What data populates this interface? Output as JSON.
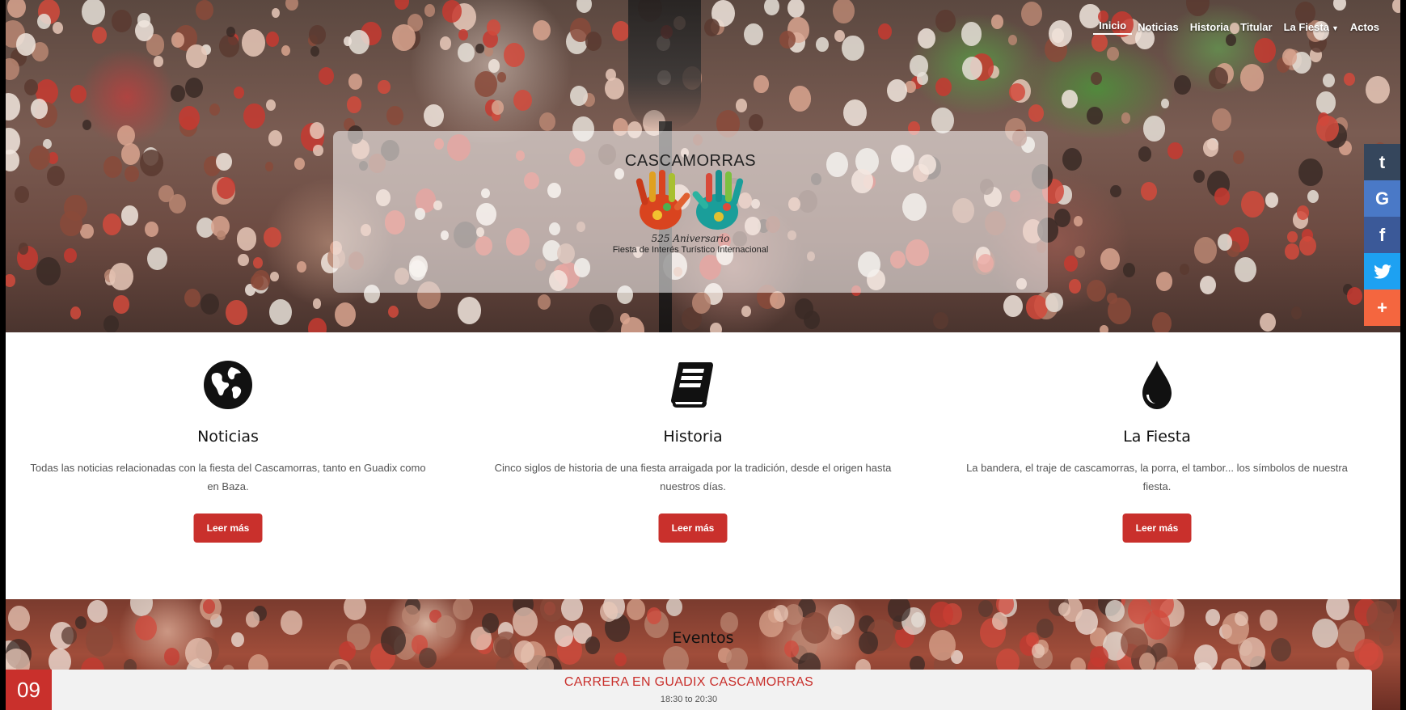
{
  "nav": {
    "items": [
      {
        "label": "Inicio",
        "active": true
      },
      {
        "label": "Noticias"
      },
      {
        "label": "Historia"
      },
      {
        "label": "Titular"
      },
      {
        "label": "La Fiesta",
        "dropdown": true
      },
      {
        "label": "Actos"
      }
    ]
  },
  "hero": {
    "logo_title": "CASCAMORRAS",
    "logo_anniversary": "525 Aniversario",
    "logo_subtitle": "Fiesta de Interés Turístico Internacional"
  },
  "social": {
    "items": [
      {
        "icon": "tumblr-icon",
        "glyph": "t",
        "color": "#35465c"
      },
      {
        "icon": "google-icon",
        "glyph": "G",
        "color": "#4a79c7"
      },
      {
        "icon": "facebook-icon",
        "glyph": "f",
        "color": "#3b5998"
      },
      {
        "icon": "twitter-icon",
        "glyph": "🐦",
        "color": "#1da1f2"
      },
      {
        "icon": "plus-icon",
        "glyph": "+",
        "color": "#f4663f"
      }
    ]
  },
  "features": [
    {
      "icon": "globe-icon",
      "title": "Noticias",
      "text": "Todas las noticias relacionadas con la fiesta del Cascamorras, tanto en Guadix como en Baza.",
      "button": "Leer más"
    },
    {
      "icon": "book-icon",
      "title": "Historia",
      "text": "Cinco siglos de historia de una fiesta arraigada por la tradición, desde el origen hasta nuestros días.",
      "button": "Leer más"
    },
    {
      "icon": "drop-icon",
      "title": "La Fiesta",
      "text": "La bandera, el traje de cascamorras, la porra, el tambor... los símbolos de nuestra fiesta.",
      "button": "Leer más"
    }
  ],
  "eventos": {
    "title": "Eventos",
    "events": [
      {
        "day": "09",
        "title": "CARRERA EN GUADIX CASCAMORRAS",
        "time": "18:30 to 20:30"
      }
    ]
  },
  "colors": {
    "accent": "#c9302c"
  }
}
